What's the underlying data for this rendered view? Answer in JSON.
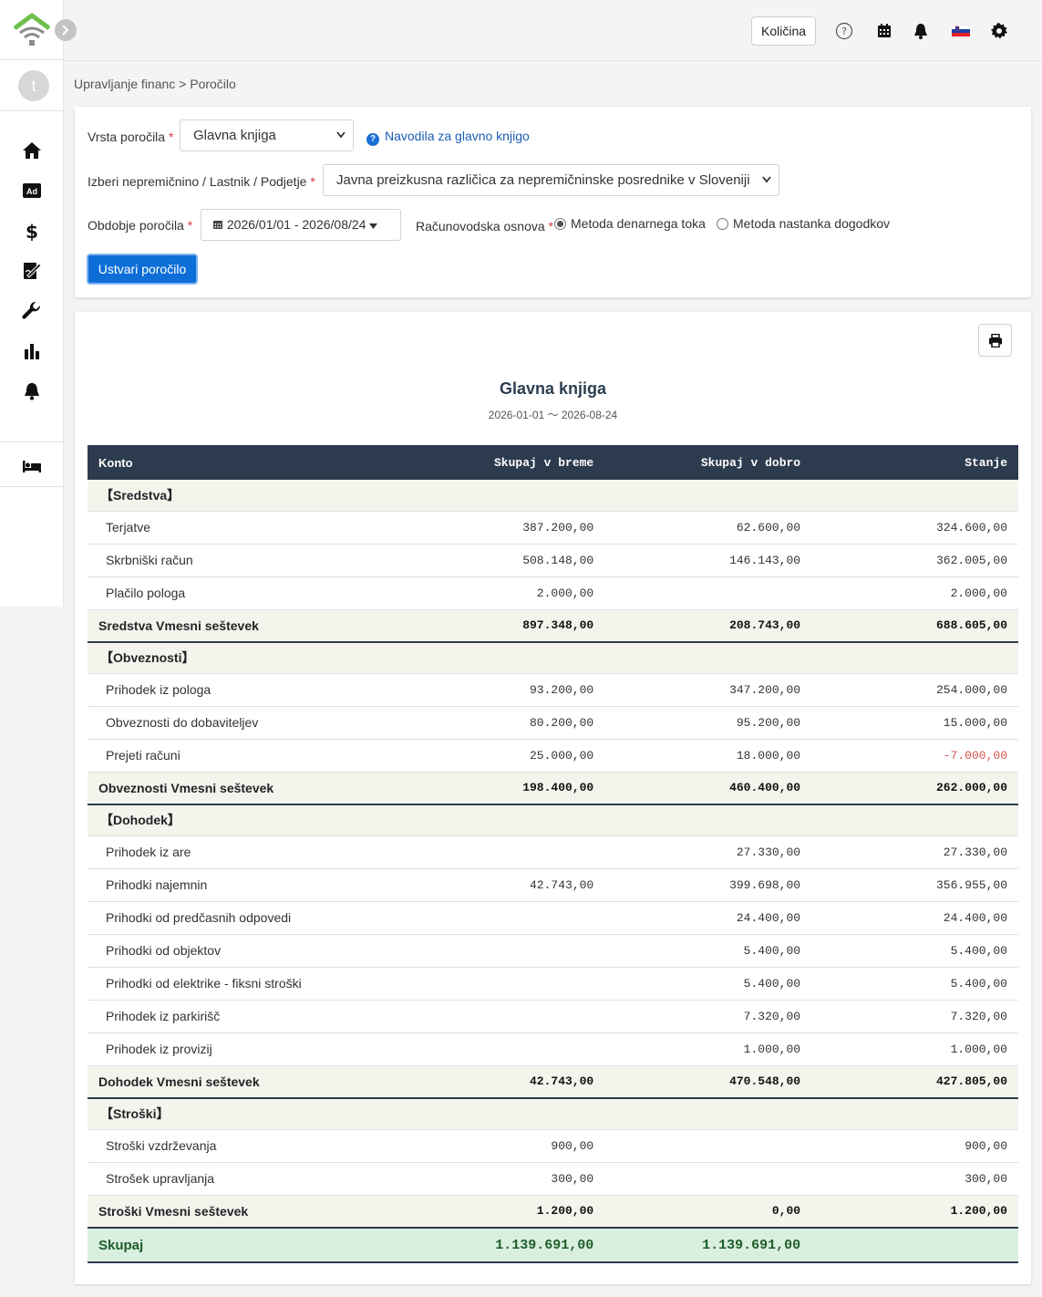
{
  "topbar": {
    "quantity_label": "Količina",
    "icons": [
      "help-icon",
      "calendar-icon",
      "bell-icon",
      "language-flag-icon",
      "gear-icon"
    ]
  },
  "sidebar": {
    "avatar_initial": "t",
    "items": [
      "home-icon",
      "ad-icon",
      "dollar-icon",
      "signature-icon",
      "wrench-icon",
      "bar-chart-icon",
      "bell-icon",
      "bed-icon"
    ]
  },
  "breadcrumb": "Upravljanje financ > Poročilo",
  "form": {
    "report_type_label": "Vrsta poročila",
    "report_type_value": "Glavna knjiga",
    "help_link": "Navodila za glavno knjigo",
    "property_label": "Izberi nepremičnino / Lastnik / Podjetje",
    "property_value": "Javna preizkusna različica za nepremičninske posrednike v Sloveniji",
    "period_label": "Obdobje poročila",
    "period_value": "2026/01/01 - 2026/08/24",
    "basis_label": "Računovodska osnova",
    "basis_options": [
      {
        "label": "Metoda denarnega toka",
        "selected": true
      },
      {
        "label": "Metoda nastanka dogodkov",
        "selected": false
      }
    ],
    "generate_label": "Ustvari poročilo"
  },
  "report": {
    "title": "Glavna knjiga",
    "period": "2026-01-01 〜 2026-08-24",
    "columns": [
      "Konto",
      "Skupaj v breme",
      "Skupaj v dobro",
      "Stanje"
    ],
    "sections": [
      {
        "name": "【Sredstva】",
        "rows": [
          {
            "account": "Terjatve",
            "debit": "387.200,00",
            "credit": "62.600,00",
            "balance": "324.600,00"
          },
          {
            "account": "Skrbniški račun",
            "debit": "508.148,00",
            "credit": "146.143,00",
            "balance": "362.005,00"
          },
          {
            "account": "Plačilo pologa",
            "debit": "2.000,00",
            "credit": "",
            "balance": "2.000,00"
          }
        ],
        "subtotal": {
          "label": "Sredstva Vmesni seštevek",
          "debit": "897.348,00",
          "credit": "208.743,00",
          "balance": "688.605,00"
        }
      },
      {
        "name": "【Obveznosti】",
        "rows": [
          {
            "account": "Prihodek iz pologa",
            "debit": "93.200,00",
            "credit": "347.200,00",
            "balance": "254.000,00"
          },
          {
            "account": "Obveznosti do dobaviteljev",
            "debit": "80.200,00",
            "credit": "95.200,00",
            "balance": "15.000,00"
          },
          {
            "account": "Prejeti računi",
            "debit": "25.000,00",
            "credit": "18.000,00",
            "balance": "-7.000,00"
          }
        ],
        "subtotal": {
          "label": "Obveznosti Vmesni seštevek",
          "debit": "198.400,00",
          "credit": "460.400,00",
          "balance": "262.000,00"
        }
      },
      {
        "name": "【Dohodek】",
        "rows": [
          {
            "account": "Prihodek iz are",
            "debit": "",
            "credit": "27.330,00",
            "balance": "27.330,00"
          },
          {
            "account": "Prihodki najemnin",
            "debit": "42.743,00",
            "credit": "399.698,00",
            "balance": "356.955,00"
          },
          {
            "account": "Prihodki od predčasnih odpovedi",
            "debit": "",
            "credit": "24.400,00",
            "balance": "24.400,00"
          },
          {
            "account": "Prihodki od objektov",
            "debit": "",
            "credit": "5.400,00",
            "balance": "5.400,00"
          },
          {
            "account": "Prihodki od elektrike - fiksni stroški",
            "debit": "",
            "credit": "5.400,00",
            "balance": "5.400,00"
          },
          {
            "account": "Prihodek iz parkirišč",
            "debit": "",
            "credit": "7.320,00",
            "balance": "7.320,00"
          },
          {
            "account": "Prihodek iz provizij",
            "debit": "",
            "credit": "1.000,00",
            "balance": "1.000,00"
          }
        ],
        "subtotal": {
          "label": "Dohodek Vmesni seštevek",
          "debit": "42.743,00",
          "credit": "470.548,00",
          "balance": "427.805,00"
        }
      },
      {
        "name": "【Stroški】",
        "rows": [
          {
            "account": "Stroški vzdrževanja",
            "debit": "900,00",
            "credit": "",
            "balance": "900,00"
          },
          {
            "account": "Strošek upravljanja",
            "debit": "300,00",
            "credit": "",
            "balance": "300,00"
          }
        ],
        "subtotal": {
          "label": "Stroški Vmesni seštevek",
          "debit": "1.200,00",
          "credit": "0,00",
          "balance": "1.200,00"
        }
      }
    ],
    "total": {
      "label": "Skupaj",
      "debit": "1.139.691,00",
      "credit": "1.139.691,00",
      "balance": ""
    }
  }
}
